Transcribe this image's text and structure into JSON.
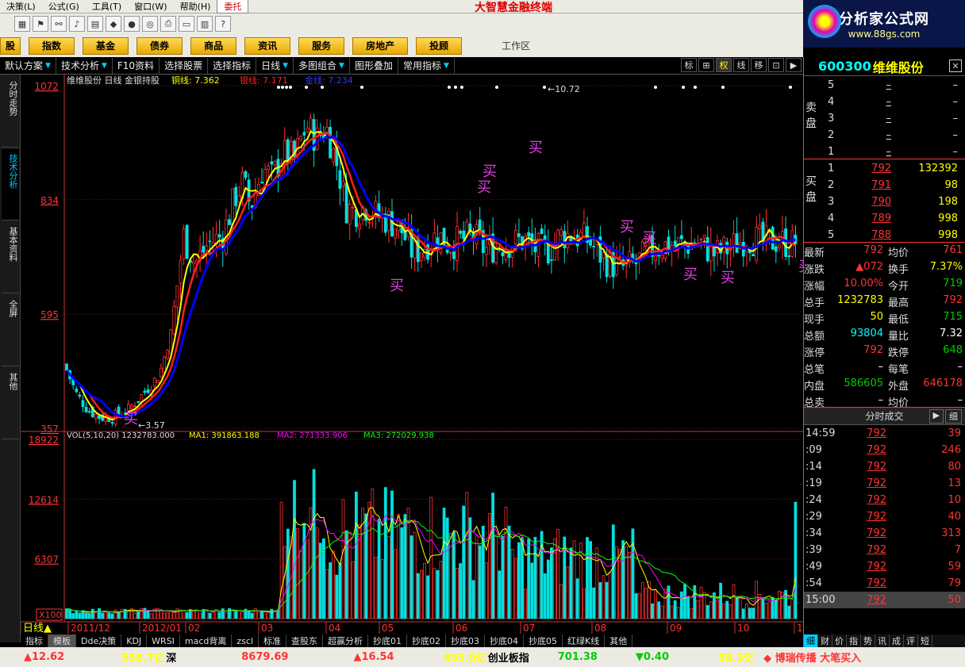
{
  "menu": {
    "items": [
      "决策(L)",
      "公式(G)",
      "工具(T)",
      "窗口(W)",
      "帮助(H)",
      "委托"
    ],
    "brand": "大智慧金融终端"
  },
  "logo": {
    "title": "分析家公式网",
    "url": "www.88gs.com"
  },
  "nav": {
    "buttons": [
      "股",
      "指数",
      "基金",
      "债券",
      "商品",
      "资讯",
      "服务",
      "房地产",
      "投顾"
    ],
    "workarea": "工作区"
  },
  "tabs": [
    {
      "label": "默认方案",
      "arrow": true
    },
    {
      "label": "技术分析",
      "arrow": true
    },
    {
      "label": "F10资料",
      "arrow": false
    },
    {
      "label": "选择股票",
      "arrow": false
    },
    {
      "label": "选择指标",
      "arrow": false
    },
    {
      "label": "日线",
      "arrow": true
    },
    {
      "label": "多图组合",
      "arrow": true
    },
    {
      "label": "图形叠加",
      "arrow": false
    },
    {
      "label": "常用指标",
      "arrow": true
    }
  ],
  "tab_right": [
    "标",
    "⊞",
    "权",
    "线",
    "移",
    "⊡",
    "▶"
  ],
  "sidetabs": [
    "分时走势",
    "技术分析",
    "基本资料",
    "全屏",
    "其他"
  ],
  "chart": {
    "header_left": "维维股份 日线 金银持股",
    "tong": "铜线: 7.362",
    "yin": "银线: 7.171",
    "jin": "金线: 7.234",
    "price_axis": [
      "1072",
      "834",
      "595",
      "357"
    ],
    "high_label": "←10.72",
    "low_label": "←3.57",
    "buy_label": "买",
    "vol_header": "VOL(5,10,20) 1232783.000",
    "ma1": "MA1: 391863.188",
    "ma2": "MA2: 271333.906",
    "ma3": "MA3: 272029.938",
    "vol_axis": [
      "18922",
      "12614",
      "6307",
      "X100"
    ],
    "date_labels": [
      "日线▲",
      "2011/12",
      "2012/01",
      "02",
      "03",
      "04",
      "05",
      "06",
      "07",
      "08",
      "09",
      "10",
      "11"
    ],
    "colors": {
      "tong": "#ffff00",
      "yin": "#ff2020",
      "jin": "#0000ff",
      "up": "#ff3030",
      "down": "#00e0e0"
    }
  },
  "footer_tabs": [
    "指标",
    "模板",
    "Dde决策",
    "KDJ",
    "WRSI",
    "macd背离",
    "zscl",
    "标准",
    "查股东",
    "超赢分析",
    "抄底01",
    "抄底02",
    "抄底03",
    "抄底04",
    "抄底05",
    "红绿K线",
    "其他"
  ],
  "status": {
    "s1_chg": "▲12.62",
    "s1_amt": "558.7亿",
    "s1_name": "深",
    "s2_val": "8679.69",
    "s2_chg": "▲16.54",
    "s2_amt": "495.9亿",
    "s2_name": "创业板指",
    "s3_val": "701.38",
    "s3_chg": "▼0.40",
    "s3_amt": "58.3亿",
    "news": "◆ 博瑞传播 大笔买入"
  },
  "panel": {
    "code": "600300",
    "name": "维维股份",
    "close_icon": "✕",
    "sell_label": "卖盘",
    "buy_label": "买盘",
    "sell": [
      {
        "lv": "5",
        "price": "–",
        "vol": "–"
      },
      {
        "lv": "4",
        "price": "–",
        "vol": "–"
      },
      {
        "lv": "3",
        "price": "–",
        "vol": "–"
      },
      {
        "lv": "2",
        "price": "–",
        "vol": "–"
      },
      {
        "lv": "1",
        "price": "–",
        "vol": "–"
      }
    ],
    "buy": [
      {
        "lv": "1",
        "price": "792",
        "vol": "132392"
      },
      {
        "lv": "2",
        "price": "791",
        "vol": "98"
      },
      {
        "lv": "3",
        "price": "790",
        "vol": "198"
      },
      {
        "lv": "4",
        "price": "789",
        "vol": "998"
      },
      {
        "lv": "5",
        "price": "788",
        "vol": "998"
      }
    ],
    "quote": [
      {
        "l1": "最新",
        "v1": "792",
        "c1": "red",
        "l2": "均价",
        "v2": "761",
        "c2": "red"
      },
      {
        "l1": "涨跌",
        "v1": "▲072",
        "c1": "red",
        "l2": "换手",
        "v2": "7.37%",
        "c2": "yel"
      },
      {
        "l1": "涨幅",
        "v1": "10.00%",
        "c1": "red",
        "l2": "今开",
        "v2": "719",
        "c2": "grn"
      },
      {
        "l1": "总手",
        "v1": "1232783",
        "c1": "yel",
        "l2": "最高",
        "v2": "792",
        "c2": "red"
      },
      {
        "l1": "现手",
        "v1": "50",
        "c1": "yel",
        "l2": "最低",
        "v2": "715",
        "c2": "grn"
      },
      {
        "l1": "总额",
        "v1": "93804",
        "c1": "cyan",
        "l2": "量比",
        "v2": "7.32",
        "c2": "wht"
      },
      {
        "l1": "涨停",
        "v1": "792",
        "c1": "red",
        "l2": "跌停",
        "v2": "648",
        "c2": "grn"
      },
      {
        "l1": "总笔",
        "v1": "–",
        "c1": "wht",
        "l2": "每笔",
        "v2": "–",
        "c2": "wht"
      },
      {
        "l1": "内盘",
        "v1": "586605",
        "c1": "grn",
        "l2": "外盘",
        "v2": "646178",
        "c2": "red"
      },
      {
        "l1": "总卖",
        "v1": "–",
        "c1": "wht",
        "l2": "均价",
        "v2": "–",
        "c2": "wht"
      },
      {
        "l1": "总买",
        "v1": "–",
        "c1": "wht",
        "l2": "均价",
        "v2": "–",
        "c2": "wht"
      }
    ],
    "ticks_title": "分时成交",
    "ticks_btn1": "▶",
    "ticks_btn2": "细",
    "ticks": [
      {
        "t": "14:59",
        "p": "792",
        "v": "39"
      },
      {
        "t": ":09",
        "p": "792",
        "v": "246"
      },
      {
        "t": ":14",
        "p": "792",
        "v": "80"
      },
      {
        "t": ":19",
        "p": "792",
        "v": "13"
      },
      {
        "t": ":24",
        "p": "792",
        "v": "10"
      },
      {
        "t": ":29",
        "p": "792",
        "v": "40"
      },
      {
        "t": ":34",
        "p": "792",
        "v": "313"
      },
      {
        "t": ":39",
        "p": "792",
        "v": "7"
      },
      {
        "t": ":49",
        "p": "792",
        "v": "59"
      },
      {
        "t": ":54",
        "p": "792",
        "v": "79"
      },
      {
        "t": "15:00",
        "p": "792",
        "v": "50"
      }
    ],
    "bottom_tabs": [
      "细",
      "财",
      "价",
      "指",
      "势",
      "讯",
      "成",
      "评",
      "短"
    ]
  }
}
